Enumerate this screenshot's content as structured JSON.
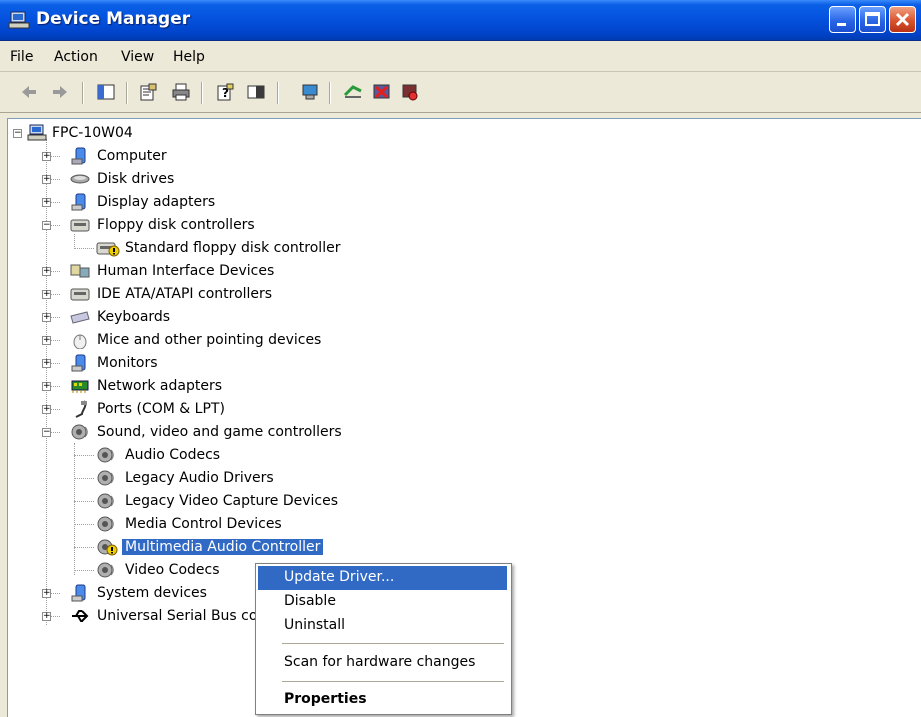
{
  "window": {
    "title": "Device Manager"
  },
  "menubar": {
    "items": [
      "File",
      "Action",
      "View",
      "Help"
    ]
  },
  "toolbar": {
    "icons": [
      "back-icon",
      "forward-icon",
      "show-hide-tree-icon",
      "properties-icon",
      "print-icon",
      "help-icon",
      "show-hide-pane-icon",
      "scan-hardware-icon",
      "update-driver-icon",
      "uninstall-icon",
      "disable-icon"
    ]
  },
  "tree": {
    "root": "FPC-10W04",
    "items": [
      {
        "label": "Computer",
        "icon": "computer-icon",
        "expanded": false
      },
      {
        "label": "Disk drives",
        "icon": "disk-drive-icon",
        "expanded": false
      },
      {
        "label": "Display adapters",
        "icon": "display-adapter-icon",
        "expanded": false
      },
      {
        "label": "Floppy disk controllers",
        "icon": "floppy-controller-icon",
        "expanded": true,
        "children": [
          {
            "label": "Standard floppy disk controller",
            "icon": "floppy-controller-warning-icon"
          }
        ]
      },
      {
        "label": "Human Interface Devices",
        "icon": "hid-icon",
        "expanded": false
      },
      {
        "label": "IDE ATA/ATAPI controllers",
        "icon": "ide-controller-icon",
        "expanded": false
      },
      {
        "label": "Keyboards",
        "icon": "keyboard-icon",
        "expanded": false
      },
      {
        "label": "Mice and other pointing devices",
        "icon": "mouse-icon",
        "expanded": false
      },
      {
        "label": "Monitors",
        "icon": "monitor-icon",
        "expanded": false
      },
      {
        "label": "Network adapters",
        "icon": "network-adapter-icon",
        "expanded": false
      },
      {
        "label": "Ports (COM & LPT)",
        "icon": "port-icon",
        "expanded": false
      },
      {
        "label": "Sound, video and game controllers",
        "icon": "sound-icon",
        "expanded": true,
        "children": [
          {
            "label": "Audio Codecs",
            "icon": "sound-icon"
          },
          {
            "label": "Legacy Audio Drivers",
            "icon": "sound-icon"
          },
          {
            "label": "Legacy Video Capture Devices",
            "icon": "sound-icon"
          },
          {
            "label": "Media Control Devices",
            "icon": "sound-icon"
          },
          {
            "label": "Multimedia Audio Controller",
            "icon": "sound-warning-icon",
            "selected": true
          },
          {
            "label": "Video Codecs",
            "icon": "sound-icon"
          }
        ]
      },
      {
        "label": "System devices",
        "icon": "system-device-icon",
        "expanded": false
      },
      {
        "label": "Universal Serial Bus cor",
        "icon": "usb-icon",
        "expanded": false
      }
    ]
  },
  "context_menu": {
    "items": [
      "Update Driver...",
      "Disable",
      "Uninstall",
      "Scan for hardware changes",
      "Properties"
    ],
    "highlighted": "Update Driver..."
  },
  "colors": {
    "titlebar": "#0553df",
    "selection": "#316ac5",
    "window_bg": "#ece9d8"
  }
}
